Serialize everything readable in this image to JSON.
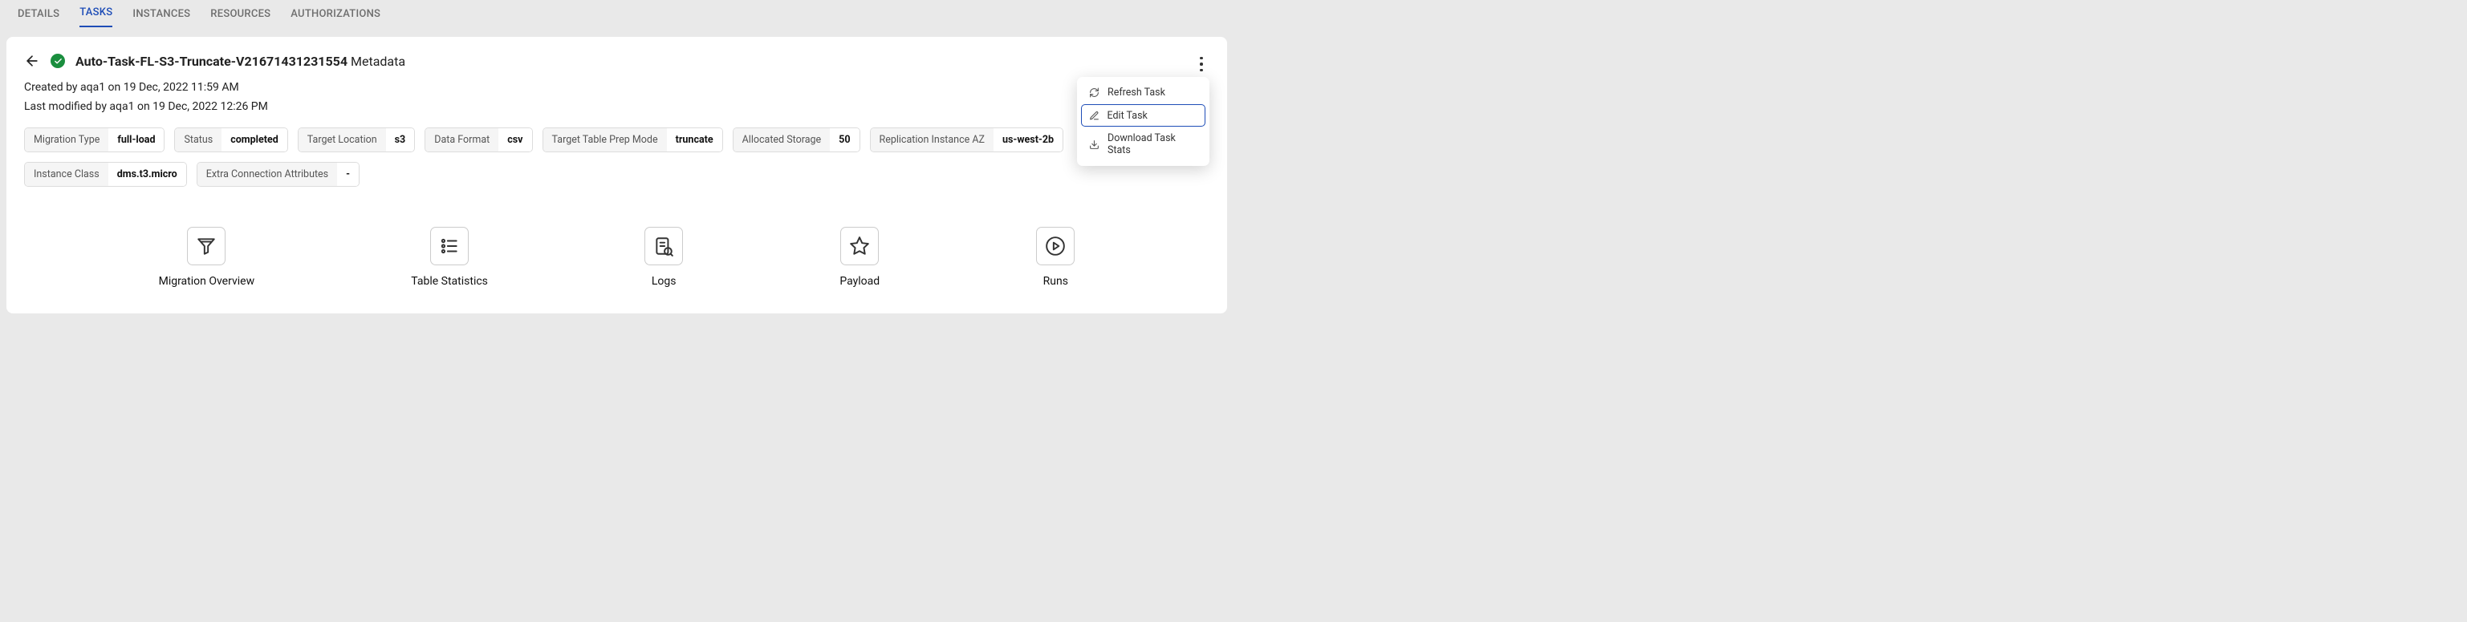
{
  "tabs": [
    "DETAILS",
    "TASKS",
    "INSTANCES",
    "RESOURCES",
    "AUTHORIZATIONS"
  ],
  "activeTab": 1,
  "title": {
    "name": "Auto-Task-FL-S3-Truncate-V21671431231554",
    "suffix": "Metadata"
  },
  "createdLine": "Created by aqa1 on 19 Dec, 2022 11:59 AM",
  "modifiedLine": "Last modified by aqa1 on 19 Dec, 2022 12:26 PM",
  "props": [
    {
      "label": "Migration Type",
      "value": "full-load"
    },
    {
      "label": "Status",
      "value": "completed"
    },
    {
      "label": "Target Location",
      "value": "s3"
    },
    {
      "label": "Data Format",
      "value": "csv"
    },
    {
      "label": "Target Table Prep Mode",
      "value": "truncate"
    },
    {
      "label": "Allocated Storage",
      "value": "50"
    },
    {
      "label": "Replication Instance AZ",
      "value": "us-west-2b"
    },
    {
      "label": "Instance Class",
      "value": "dms.t3.micro"
    },
    {
      "label": "Extra Connection Attributes",
      "value": "-"
    }
  ],
  "dropdown": {
    "refresh": "Refresh Task",
    "edit": "Edit Task",
    "download": "Download Task Stats"
  },
  "nav": {
    "overview": "Migration Overview",
    "stats": "Table Statistics",
    "logs": "Logs",
    "payload": "Payload",
    "runs": "Runs"
  }
}
